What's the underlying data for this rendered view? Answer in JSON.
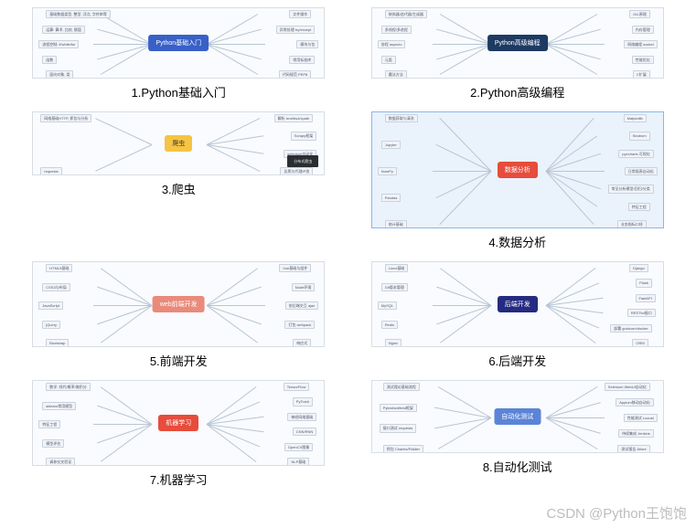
{
  "watermark": "CSDN @Python王饱饱",
  "items": [
    {
      "caption": "1.Python基础入门",
      "center_label": "Python基础入门",
      "center_color": "blue",
      "height": 78,
      "selected": false,
      "branches_left": [
        "基础数据类型: 整型, 浮点, 字符串等",
        "运算: 算术, 比较, 赋值",
        "流程控制: if/while/for",
        "函数",
        "面向对象, 类"
      ],
      "branches_right": [
        "文件操作",
        "异常处理 try/except",
        "模块与包",
        "常用标准库",
        "代码规范 PEP8"
      ]
    },
    {
      "caption": "2.Python高级编程",
      "center_label": "Python高级编程",
      "center_color": "navy",
      "height": 78,
      "selected": false,
      "branches_left": [
        "装饰器/迭代器/生成器",
        "多线程/多进程",
        "协程 asyncio",
        "元类",
        "魔法方法"
      ],
      "branches_right": [
        "GIL原理",
        "内存管理",
        "网络编程 socket",
        "性能优化",
        "C扩展"
      ]
    },
    {
      "caption": "3.爬虫",
      "center_label": "爬虫",
      "center_color": "yellow",
      "height": 70,
      "selected": false,
      "branches_left": [
        "网络基础HTTP, 抓包与分析",
        "requests"
      ],
      "branches_right": [
        "解析 lxml/bs4/xpath",
        "Scrapy框架",
        "selenium自动化",
        "反爬与代理IP池"
      ],
      "has_dark_box": true,
      "dark_box_text": "分布式爬虫"
    },
    {
      "caption": "4.数据分析",
      "center_label": "数据分析",
      "center_color": "red",
      "height": 128,
      "selected": true,
      "branches_left": [
        "数据获取与清洗",
        "Jupyter",
        "NumPy",
        "Pandas",
        "统计基础"
      ],
      "branches_right": [
        "Matplotlib",
        "Seaborn",
        "pyecharts 可视化",
        "日常报表自动化",
        "常见分析模型/回归/分类",
        "特征工程",
        "业务指标口径"
      ]
    },
    {
      "caption": "5.前端开发",
      "center_label": "web前端开发",
      "center_color": "pink",
      "height": 94,
      "selected": false,
      "branches_left": [
        "HTML5基础",
        "CSS3与布局",
        "JavaScript",
        "jQuery",
        "Bootstrap"
      ],
      "branches_right": [
        "Vue基础与组件",
        "Node环境",
        "前后端交互 ajax",
        "打包 webpack",
        "响应式"
      ]
    },
    {
      "caption": "6.后端开发",
      "center_label": "后端开发",
      "center_color": "indigo",
      "height": 94,
      "selected": false,
      "branches_left": [
        "Linux基础",
        "Git版本管理",
        "MySQL",
        "Redis",
        "Nginx"
      ],
      "branches_right": [
        "Django",
        "Flask",
        "FastAPI",
        "RESTful接口",
        "部署 gunicorn/docker",
        "ORM"
      ]
    },
    {
      "caption": "7.机器学习",
      "center_label": "机器学习",
      "center_color": "red",
      "height": 94,
      "selected": false,
      "branches_left": [
        "数学: 线代/概率/微积分",
        "sklearn常用模型",
        "特征工程",
        "模型评估",
        "调参交叉验证"
      ],
      "branches_right": [
        "TensorFlow",
        "PyTorch",
        "神经网络基础",
        "CNN/RNN",
        "OpenCV图像",
        "NLP基础"
      ]
    },
    {
      "caption": "8.自动化测试",
      "center_label": "自动化测试",
      "center_color": "lblue",
      "height": 80,
      "selected": false,
      "branches_left": [
        "测试理论基础流程",
        "Pytest/unittest框架",
        "接口测试 requests",
        "抓包 Charles/Fiddler"
      ],
      "branches_right": [
        "Selenium WebUI自动化",
        "Appium移动自动化",
        "性能测试 Locust",
        "持续集成 Jenkins",
        "测试报告 Allure"
      ]
    }
  ]
}
